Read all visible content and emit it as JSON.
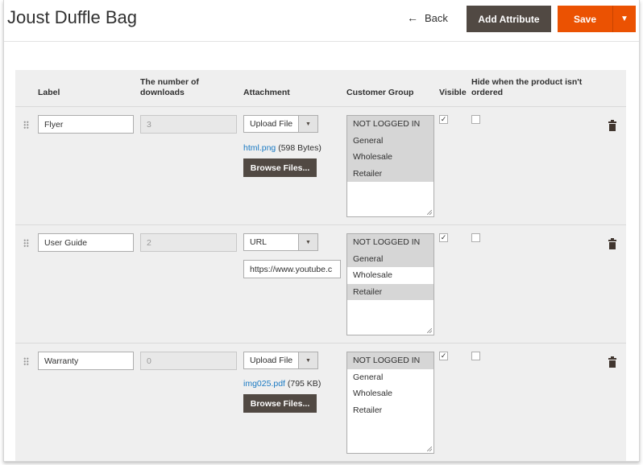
{
  "header": {
    "title": "Joust Duffle Bag",
    "back_label": "Back",
    "add_attribute_label": "Add Attribute",
    "save_label": "Save"
  },
  "columns": {
    "label": "Label",
    "downloads_line1": "The number of",
    "downloads_line2": "downloads",
    "attachment": "Attachment",
    "customer_group": "Customer Group",
    "visible": "Visible",
    "hide_line1": "Hide when the product isn't",
    "hide_line2": "ordered"
  },
  "browse_label": "Browse Files...",
  "rows": [
    {
      "label": "Flyer",
      "downloads": "3",
      "attachment_type": "Upload File",
      "file_name": "html.png",
      "file_size": "(598 Bytes)",
      "url": "",
      "groups": [
        {
          "name": "NOT LOGGED IN",
          "selected": true
        },
        {
          "name": "General",
          "selected": true
        },
        {
          "name": "Wholesale",
          "selected": true
        },
        {
          "name": "Retailer",
          "selected": true
        }
      ],
      "visible": true,
      "hide_unordered": false
    },
    {
      "label": "User Guide",
      "downloads": "2",
      "attachment_type": "URL",
      "file_name": "",
      "file_size": "",
      "url": "https://www.youtube.c",
      "groups": [
        {
          "name": "NOT LOGGED IN",
          "selected": true
        },
        {
          "name": "General",
          "selected": true
        },
        {
          "name": "Wholesale",
          "selected": false
        },
        {
          "name": "Retailer",
          "selected": true
        }
      ],
      "visible": true,
      "hide_unordered": false
    },
    {
      "label": "Warranty",
      "downloads": "0",
      "attachment_type": "Upload File",
      "file_name": "img025.pdf",
      "file_size": "(795 KB)",
      "url": "",
      "groups": [
        {
          "name": "NOT LOGGED IN",
          "selected": true
        },
        {
          "name": "General",
          "selected": false
        },
        {
          "name": "Wholesale",
          "selected": false
        },
        {
          "name": "Retailer",
          "selected": false
        }
      ],
      "visible": true,
      "hide_unordered": false
    }
  ],
  "icons": {
    "back": "arrow-left-icon",
    "dropdown": "chevron-down-icon",
    "drag": "drag-handle-icon",
    "delete": "trash-icon",
    "check": "checkmark-icon"
  },
  "colors": {
    "primary": "#eb5202",
    "secondary": "#514943",
    "link": "#1979c3",
    "grid_bg": "#efefef"
  }
}
